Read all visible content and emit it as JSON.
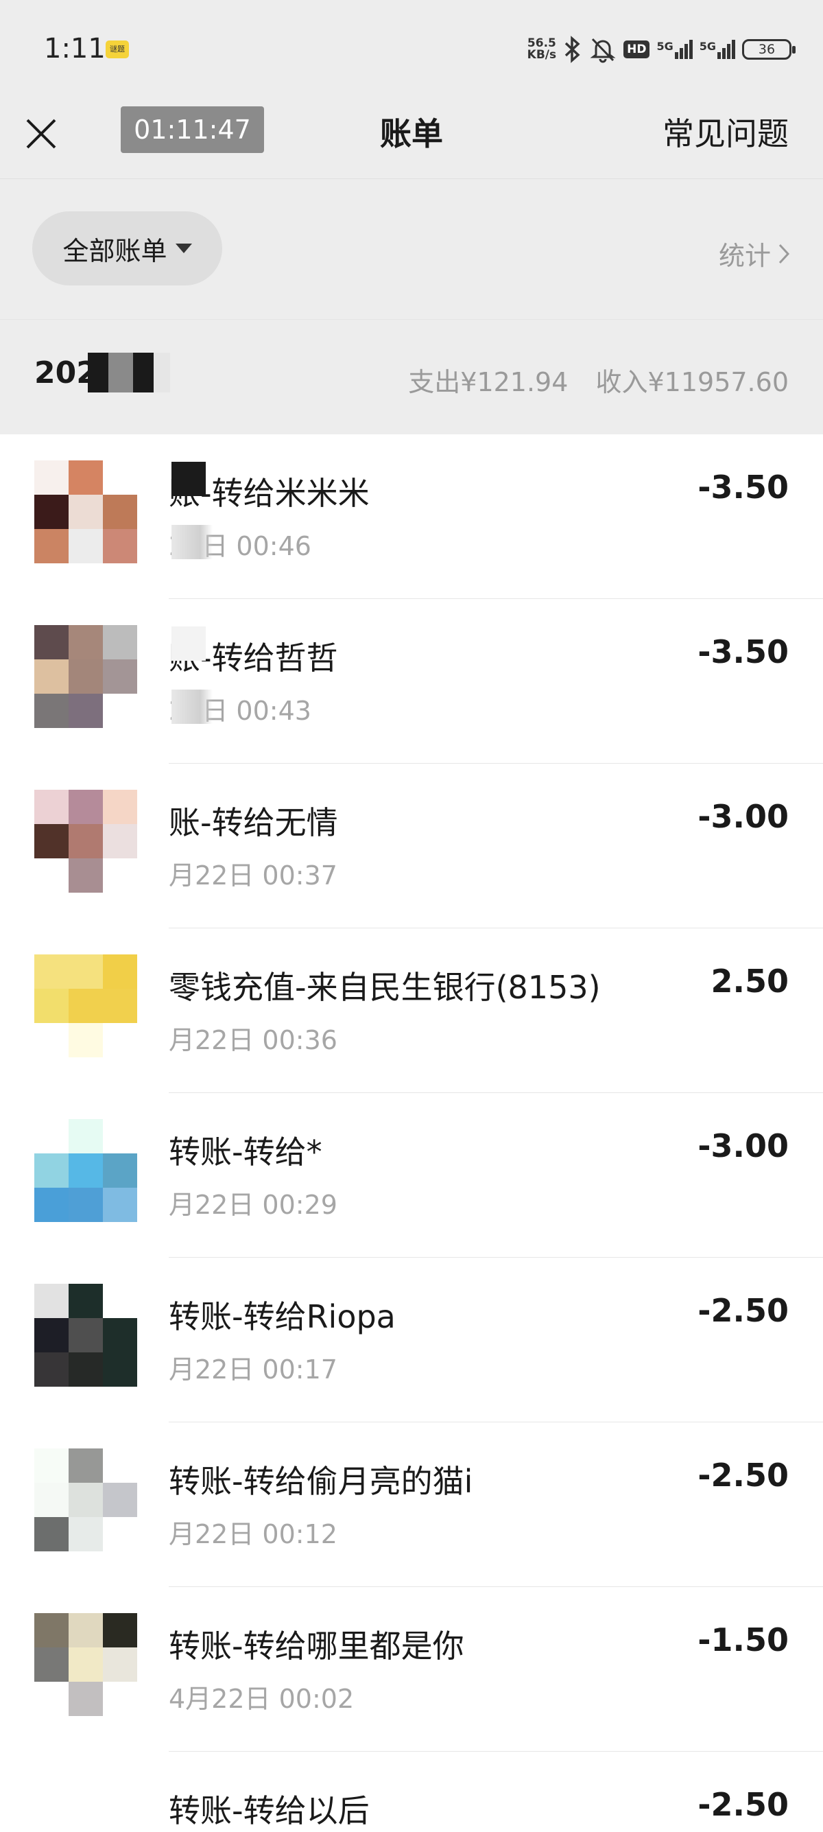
{
  "status_bar": {
    "time": "1:11",
    "badge": "谜题",
    "net_speed_value": "56.5",
    "net_speed_unit": "KB/s",
    "hd_label": "HD",
    "signal1": "5G",
    "signal2": "5G",
    "battery": "36"
  },
  "header": {
    "timer": "01:11:47",
    "title": "账单",
    "faq": "常见问题"
  },
  "filter": {
    "label": "全部账单",
    "stats": "统计"
  },
  "month": {
    "label": "202",
    "expense": "支出¥121.94",
    "income": "收入¥11957.60"
  },
  "transactions": [
    {
      "name": "账-转给米米米",
      "date": "22日 00:46",
      "amount": "-3.50",
      "avatar": [
        "#f7f0ed",
        "#d58462",
        "#ffffff",
        "#3b1b1a",
        "#ecdcd4",
        "#be7a58",
        "#cb8463",
        "#ececec",
        "#cc8876"
      ]
    },
    {
      "name": "账-转给哲哲",
      "date": "22日 00:43",
      "amount": "-3.50",
      "avatar": [
        "#5e4b4d",
        "#a6877a",
        "#bcbcbc",
        "#ddc0a0",
        "#a3867a",
        "#a39596",
        "#7a7677",
        "#7d6f7d",
        "#ffffff"
      ]
    },
    {
      "name": "账-转给无情",
      "date": "月22日 00:37",
      "amount": "-3.00",
      "avatar": [
        "#ecd1d4",
        "#b58b9a",
        "#f5d6c6",
        "#513229",
        "#b07a70",
        "#ebdfdf",
        "#ffffff",
        "#a88e92",
        "#ffffff"
      ]
    },
    {
      "name": "零钱充值-来自民生银行(8153)",
      "date": "月22日 00:36",
      "amount": "2.50",
      "avatar": [
        "#f5e17e",
        "#f5e17e",
        "#f1cf48",
        "#f2de6c",
        "#f1d04d",
        "#f1d04d",
        "#ffffff",
        "#fffbe2",
        "#ffffff"
      ]
    },
    {
      "name": "转账-转给*",
      "date": "月22日 00:29",
      "amount": "-3.00",
      "avatar": [
        "#ffffff",
        "#e6fbf3",
        "#ffffff",
        "#91d3e2",
        "#56b8e6",
        "#5ba4c6",
        "#4a9fd8",
        "#4f9fd6",
        "#7fbbe2"
      ]
    },
    {
      "name": "转账-转给Riopa",
      "date": "月22日 00:17",
      "amount": "-2.50",
      "avatar": [
        "#e2e2e2",
        "#1d2e2a",
        "#ffffff",
        "#1d1e26",
        "#4f4f4f",
        "#1e2e2a",
        "#373537",
        "#262927",
        "#1e2e2a"
      ]
    },
    {
      "name": "转账-转给偷月亮的猫i",
      "date": "月22日 00:12",
      "amount": "-2.50",
      "avatar": [
        "#f7fcf7",
        "#979896",
        "#ffffff",
        "#f5f9f5",
        "#dde1dd",
        "#c5c6cb",
        "#6c6e6d",
        "#e7ebe9",
        "#ffffff"
      ]
    },
    {
      "name": "转账-转给哪里都是你",
      "date": "4月22日 00:02",
      "amount": "-1.50",
      "avatar": [
        "#7f7767",
        "#e0d8bf",
        "#2a2a22",
        "#787876",
        "#f1e9c6",
        "#e9e6dc",
        "#ffffff",
        "#c2bfc0",
        "#ffffff"
      ]
    },
    {
      "name": "转账-转给以后",
      "date": "",
      "amount": "-2.50",
      "avatar": [
        "#ffffff",
        "#ffffff",
        "#ffffff",
        "#ffffff",
        "#ffffff",
        "#ffffff",
        "#b3b3b3",
        "#b8b8b8",
        "#a8abb0"
      ]
    }
  ]
}
